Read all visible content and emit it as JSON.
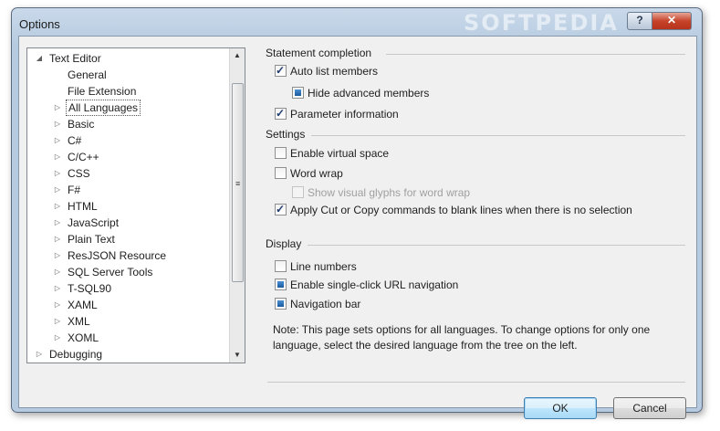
{
  "window": {
    "title": "Options",
    "watermark": "SOFTPEDIA"
  },
  "titlebar": {
    "help_label": "?",
    "close_label": "✕"
  },
  "tree": {
    "items": [
      {
        "label": "Text Editor",
        "expander": "◢",
        "level": 0
      },
      {
        "label": "General",
        "expander": "",
        "level": 1
      },
      {
        "label": "File Extension",
        "expander": "",
        "level": 1
      },
      {
        "label": "All Languages",
        "expander": "▷",
        "level": 1,
        "selected": true
      },
      {
        "label": "Basic",
        "expander": "▷",
        "level": 1
      },
      {
        "label": "C#",
        "expander": "▷",
        "level": 1
      },
      {
        "label": "C/C++",
        "expander": "▷",
        "level": 1
      },
      {
        "label": "CSS",
        "expander": "▷",
        "level": 1
      },
      {
        "label": "F#",
        "expander": "▷",
        "level": 1
      },
      {
        "label": "HTML",
        "expander": "▷",
        "level": 1
      },
      {
        "label": "JavaScript",
        "expander": "▷",
        "level": 1
      },
      {
        "label": "Plain Text",
        "expander": "▷",
        "level": 1
      },
      {
        "label": "ResJSON Resource",
        "expander": "▷",
        "level": 1
      },
      {
        "label": "SQL Server Tools",
        "expander": "▷",
        "level": 1
      },
      {
        "label": "T-SQL90",
        "expander": "▷",
        "level": 1
      },
      {
        "label": "XAML",
        "expander": "▷",
        "level": 1
      },
      {
        "label": "XML",
        "expander": "▷",
        "level": 1
      },
      {
        "label": "XOML",
        "expander": "▷",
        "level": 1
      },
      {
        "label": "Debugging",
        "expander": "▷",
        "level": 0
      }
    ],
    "scroll_up": "▲",
    "scroll_down": "▼",
    "grip": "≡"
  },
  "statement_completion": {
    "title": "Statement completion",
    "auto_list_members": {
      "label": "Auto list members",
      "state": "checked"
    },
    "hide_advanced_members": {
      "label": "Hide advanced members",
      "state": "indeterminate"
    },
    "parameter_information": {
      "label": "Parameter information",
      "state": "checked"
    }
  },
  "settings": {
    "title": "Settings",
    "enable_virtual_space": {
      "label": "Enable virtual space",
      "state": "unchecked"
    },
    "word_wrap": {
      "label": "Word wrap",
      "state": "unchecked"
    },
    "show_visual_glyphs": {
      "label": "Show visual glyphs for word wrap",
      "state": "disabled"
    },
    "apply_cut_copy": {
      "label": "Apply Cut or Copy commands to blank lines when there is no selection",
      "state": "checked"
    }
  },
  "display": {
    "title": "Display",
    "line_numbers": {
      "label": "Line numbers",
      "state": "unchecked"
    },
    "single_click_url": {
      "label": "Enable single-click URL navigation",
      "state": "indeterminate"
    },
    "navigation_bar": {
      "label": "Navigation bar",
      "state": "indeterminate"
    },
    "note": "Note: This page sets options for all languages. To change options for only one language, select the desired language from the tree on the left."
  },
  "buttons": {
    "ok": "OK",
    "cancel": "Cancel"
  }
}
